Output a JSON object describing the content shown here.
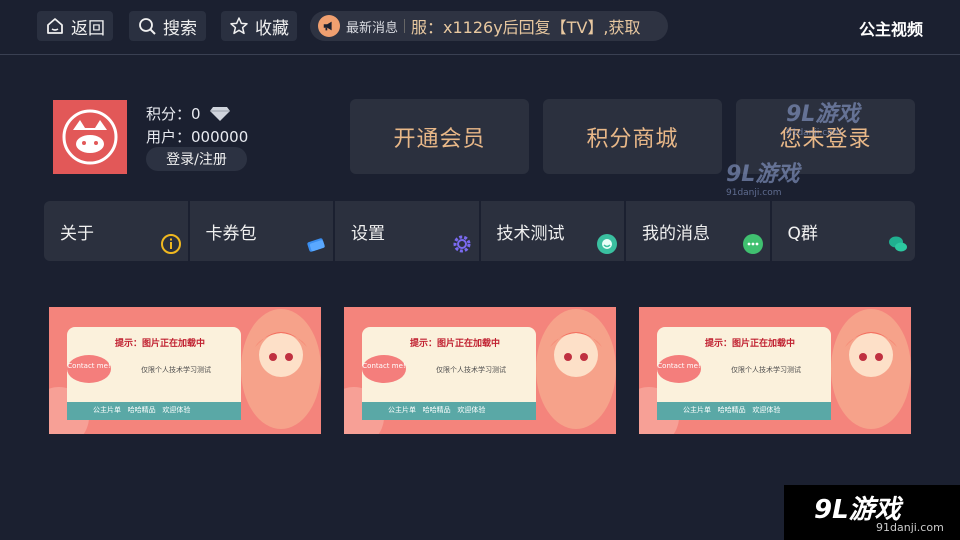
{
  "topbar": {
    "back_label": "返回",
    "search_label": "搜索",
    "favorite_label": "收藏",
    "news_label": "最新消息",
    "news_text": "服：x1126y后回复【TV】,获取",
    "app_title": "公主视频"
  },
  "profile": {
    "points_label": "积分：0",
    "user_label": "用户：000000",
    "login_button": "登录/注册"
  },
  "actions": {
    "vip": "开通会员",
    "shop": "积分商城",
    "login_status": "您未登录"
  },
  "menu": [
    {
      "label": "关于",
      "icon": "info-icon"
    },
    {
      "label": "卡券包",
      "icon": "ticket-icon"
    },
    {
      "label": "设置",
      "icon": "gear-icon"
    },
    {
      "label": "技术测试",
      "icon": "smile-icon"
    },
    {
      "label": "我的消息",
      "icon": "chat-icon"
    },
    {
      "label": "Q群",
      "icon": "wechat-icon"
    }
  ],
  "banners": [
    {
      "title": "提示：图片正在加载中",
      "note": "仅限个人技术学习测试",
      "bubble": "Contact me!",
      "footer": "公主片单   哈哈精品   欢迎体验"
    },
    {
      "title": "提示：图片正在加载中",
      "note": "仅限个人技术学习测试",
      "bubble": "Contact me!",
      "footer": "公主片单   哈哈精品   欢迎体验"
    },
    {
      "title": "提示：图片正在加载中",
      "note": "仅限个人技术学习测试",
      "bubble": "Contact me!",
      "footer": "公主片单   哈哈精品   欢迎体验"
    }
  ],
  "watermark": {
    "brand": "9L游戏",
    "site": "91danji.com"
  },
  "colors": {
    "background": "#1b2030",
    "panel": "#2b303e",
    "accent": "#e9b888"
  }
}
